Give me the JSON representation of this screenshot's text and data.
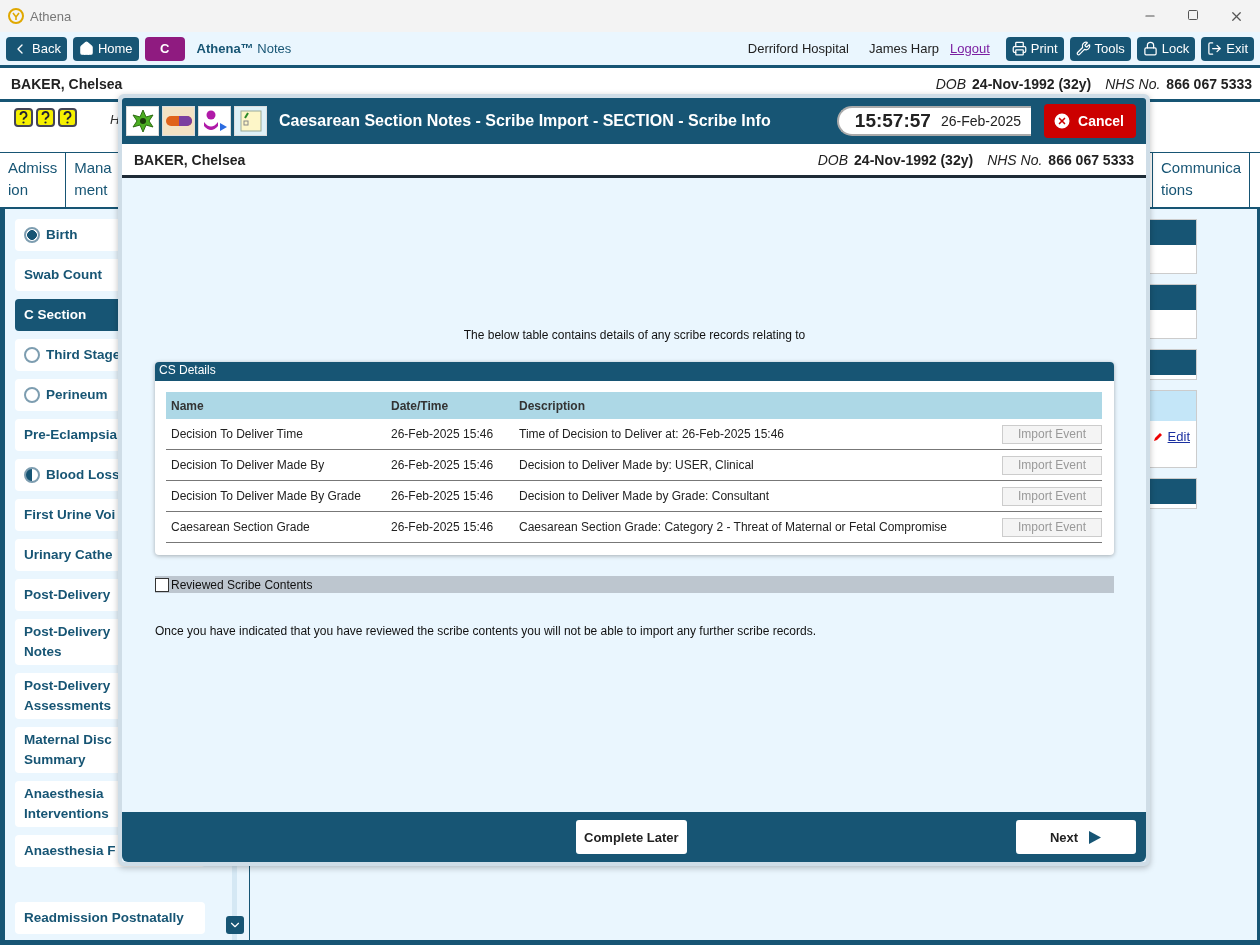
{
  "window": {
    "title": "Athena"
  },
  "toolbar": {
    "left_buttons": [
      {
        "kind": "back",
        "label": "Back"
      },
      {
        "kind": "home",
        "label": "Home"
      },
      {
        "kind": "context",
        "label": "C"
      }
    ],
    "app_name": {
      "brand": "Athena™",
      "suffix": "Notes"
    },
    "location": "Derriford Hospital",
    "user": "James Harp",
    "logout": "Logout",
    "right_buttons": [
      {
        "kind": "print",
        "label": "Print"
      },
      {
        "kind": "tools",
        "label": "Tools"
      },
      {
        "kind": "lock",
        "label": "Lock"
      },
      {
        "kind": "exit",
        "label": "Exit"
      }
    ]
  },
  "patient": {
    "name": "BAKER, Chelsea",
    "dob_label": "DOB",
    "dob": "24-Nov-1992 (32y)",
    "nhs_label": "NHS No.",
    "nhs": "866 067 5333"
  },
  "header_text": "H",
  "tabs": [
    {
      "lines": [
        "Admiss",
        "ion"
      ],
      "selected": false
    },
    {
      "lines": [
        "Mana",
        "ment"
      ],
      "selected": false
    },
    {
      "lines": [
        "Communica",
        "tions"
      ],
      "selected": false
    }
  ],
  "sidebar": [
    {
      "label": "Birth",
      "kind": "complete",
      "selected": false
    },
    {
      "label": "Swab Count",
      "kind": "plain",
      "selected": false
    },
    {
      "label": "C Section",
      "kind": "plain",
      "selected": true
    },
    {
      "label": "Third Stage",
      "kind": "empty",
      "selected": false
    },
    {
      "label": "Perineum",
      "kind": "empty",
      "selected": false
    },
    {
      "label": "Pre-Eclampsia",
      "kind": "plain",
      "selected": false
    },
    {
      "label": "Blood Loss",
      "kind": "partial",
      "selected": false
    },
    {
      "label": "First Urine Voi",
      "kind": "plain",
      "selected": false
    },
    {
      "label": "Urinary Cathe",
      "kind": "plain",
      "selected": false
    },
    {
      "label": "Post-Delivery",
      "kind": "plain",
      "selected": false
    },
    {
      "label": "Post-Delivery\nNotes",
      "kind": "plain",
      "selected": false
    },
    {
      "label": "Post-Delivery\nAssessments",
      "kind": "plain",
      "selected": false
    },
    {
      "label": "Maternal Disc\nSummary",
      "kind": "plain",
      "selected": false
    },
    {
      "label": "Anaesthesia\nInterventions",
      "kind": "plain",
      "selected": false
    },
    {
      "label": "Anaesthesia F",
      "kind": "plain",
      "selected": false
    },
    {
      "label": "Readmission Postnatally",
      "kind": "plain",
      "selected": false
    }
  ],
  "right_panels": [
    {
      "kind": "header"
    },
    {
      "kind": "header"
    },
    {
      "kind": "strip"
    },
    {
      "kind": "edit",
      "link": "Edit"
    },
    {
      "kind": "strip"
    }
  ],
  "dialog": {
    "title": "Caesarean Section Notes - Scribe Import - SECTION - Scribe Info",
    "time": "15:57:57",
    "date": "26-Feb-2025",
    "cancel": "Cancel",
    "patient": {
      "name": "BAKER, Chelsea",
      "dob_label": "DOB",
      "dob": "24-Nov-1992 (32y)",
      "nhs_label": "NHS No.",
      "nhs": "866 067 5333"
    },
    "intro": "The below table contains details of any scribe records relating to",
    "panel_title": "CS Details",
    "columns": [
      "Name",
      "Date/Time",
      "Description"
    ],
    "rows": [
      {
        "name": "Decision To Deliver Time",
        "datetime": "26-Feb-2025 15:46",
        "description": "Time of Decision to Deliver at: 26-Feb-2025 15:46",
        "action": "Import Event",
        "disabled": true
      },
      {
        "name": "Decision To Deliver Made By",
        "datetime": "26-Feb-2025 15:46",
        "description": "Decision to Deliver Made by: USER, Clinical",
        "action": "Import Event",
        "disabled": true
      },
      {
        "name": "Decision To Deliver Made By Grade",
        "datetime": "26-Feb-2025 15:46",
        "description": "Decision to Deliver Made by Grade: Consultant",
        "action": "Import Event",
        "disabled": true
      },
      {
        "name": "Caesarean Section Grade",
        "datetime": "26-Feb-2025 15:46",
        "description": "Caesarean Section Grade: Category 2 - Threat of Maternal or Fetal Compromise",
        "action": "Import Event",
        "disabled": true
      }
    ],
    "reviewed": {
      "label": "Reviewed Scribe Contents",
      "checked": false
    },
    "note": "Once you have indicated that you have reviewed the scribe contents you will not be able to import any further scribe records.",
    "complete_later": "Complete Later",
    "next": "Next"
  }
}
